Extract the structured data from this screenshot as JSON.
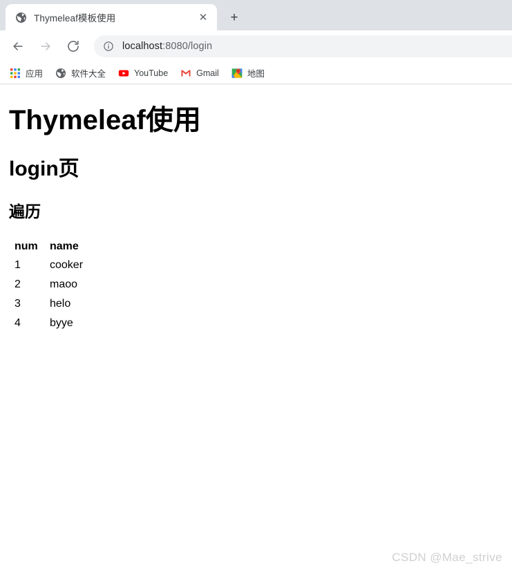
{
  "browser": {
    "tab": {
      "title": "Thymeleaf模板使用",
      "favicon": "globe-icon",
      "close_label": "✕"
    },
    "new_tab_label": "+",
    "nav": {
      "back_label": "←",
      "forward_label": "→",
      "reload_label": "⟳"
    },
    "omnibox": {
      "info_icon": "info-circle-icon",
      "host": "localhost",
      "path": ":8080/login",
      "full_url": "localhost:8080/login"
    },
    "bookmarks": [
      {
        "label": "应用",
        "icon": "apps-grid-icon"
      },
      {
        "label": "软件大全",
        "icon": "globe-icon"
      },
      {
        "label": "YouTube",
        "icon": "youtube-icon"
      },
      {
        "label": "Gmail",
        "icon": "gmail-icon"
      },
      {
        "label": "地图",
        "icon": "google-maps-icon"
      }
    ]
  },
  "page": {
    "h1": "Thymeleaf使用",
    "h2": "login页",
    "h3": "遍历",
    "table": {
      "headers": [
        "num",
        "name"
      ],
      "rows": [
        {
          "num": "1",
          "name": "cooker"
        },
        {
          "num": "2",
          "name": "maoo"
        },
        {
          "num": "3",
          "name": "helo"
        },
        {
          "num": "4",
          "name": "byye"
        }
      ]
    }
  },
  "watermark": "CSDN @Mae_strive",
  "colors": {
    "tabstrip_bg": "#dee1e6",
    "omnibox_bg": "#f1f3f4",
    "text_primary": "#202124",
    "text_secondary": "#5f6368",
    "youtube_red": "#ff0000",
    "gmail_red": "#ea4335",
    "maps_green": "#34a853",
    "maps_blue": "#4285f4",
    "maps_yellow": "#fbbc04",
    "watermark_gray": "#d0d0d0"
  }
}
